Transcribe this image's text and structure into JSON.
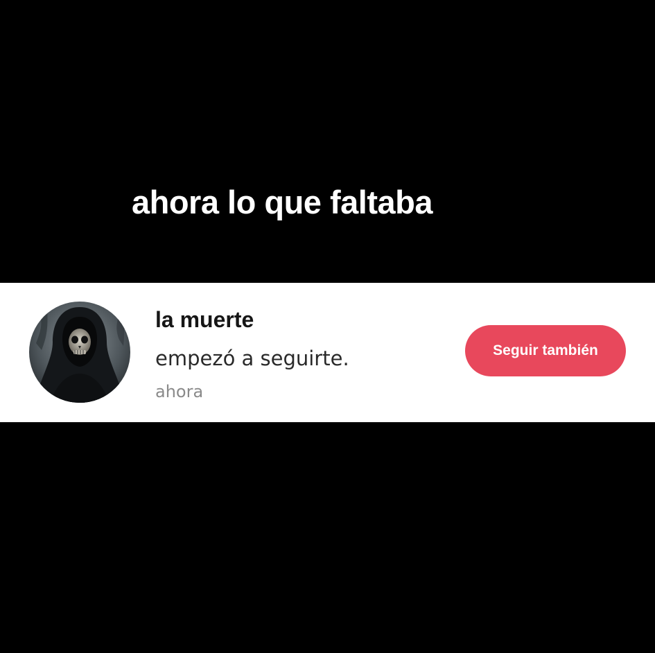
{
  "caption": "ahora lo que faltaba",
  "notification": {
    "avatar_icon": "grim-reaper-avatar",
    "username": "la muerte",
    "message": "empezó a seguirte.",
    "timestamp": "ahora",
    "follow_back_label": "Seguir también",
    "button_color": "#e8485c"
  }
}
